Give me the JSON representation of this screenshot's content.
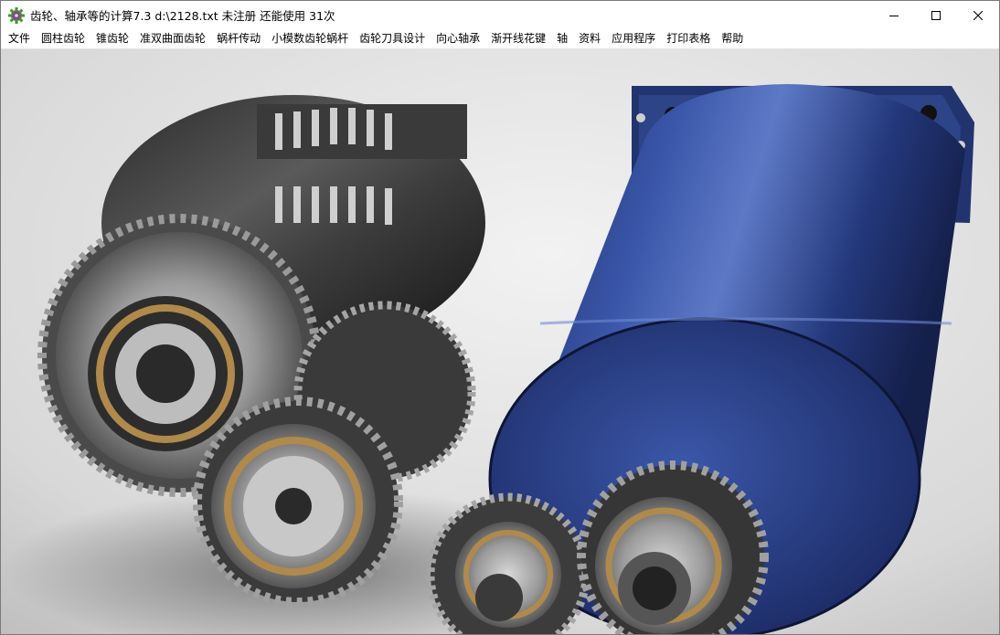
{
  "window": {
    "app_icon": "gear-icon",
    "title": "齿轮、轴承等的计算7.3    d:\\2128.txt 未注册 还能使用 31次",
    "controls": {
      "minimize_icon": "minimize-icon",
      "maximize_icon": "maximize-icon",
      "close_icon": "close-icon"
    }
  },
  "menu": {
    "items": [
      {
        "label": "文件"
      },
      {
        "label": "圆柱齿轮"
      },
      {
        "label": "锥齿轮"
      },
      {
        "label": "准双曲面齿轮"
      },
      {
        "label": "蜗杆传动"
      },
      {
        "label": "小模数齿轮蜗杆"
      },
      {
        "label": "齿轮刀具设计"
      },
      {
        "label": "向心轴承"
      },
      {
        "label": "渐开线花键"
      },
      {
        "label": "轴"
      },
      {
        "label": "资料"
      },
      {
        "label": "应用程序"
      },
      {
        "label": "打印表格"
      },
      {
        "label": "帮助"
      }
    ]
  },
  "content": {
    "image_subject": "gearbox-render",
    "colors": {
      "motor_blue": "#2b3f86",
      "gear_metal": "#8e8e8e",
      "bearing_brass": "#b08a4a",
      "background": "#e4e4e4"
    }
  }
}
